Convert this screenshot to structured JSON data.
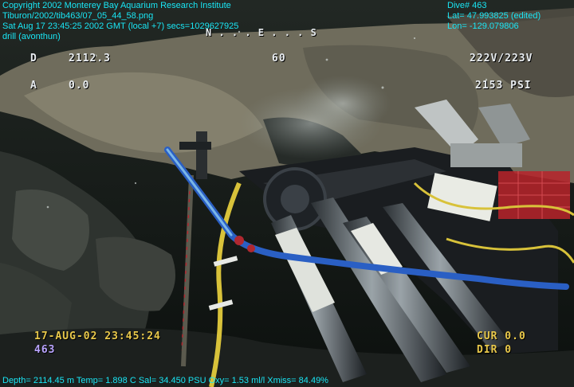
{
  "header": {
    "copyright": "Copyright 2002 Monterey Bay Aquarium Research Institute",
    "file_path": "Tiburon/2002/tib463/07_05_44_58.png",
    "timestamp": "Sat Aug 17 23:45:25 2002 GMT (local +7) secs=1029627925",
    "label": "drill (avonthun)"
  },
  "header_right": {
    "dive": "Dive# 463",
    "lat": "Lat= 47.993825 (edited)",
    "lon": "Lon= -129.079806"
  },
  "hud": {
    "compass": "N  .  .  .  E  .  .  .  S",
    "depth_label": "D",
    "depth_value": "2112.3",
    "heading": "60",
    "alt_label": "A",
    "alt_value": "0.0",
    "voltage": "222V/223V",
    "pressure": "2153 PSI",
    "datetime": "17-AUG-02 23:45:24",
    "dive_num": "463",
    "cur": "CUR 0.0",
    "dir": "DIR 0"
  },
  "footer": {
    "sensors": "Depth= 2114.45 m  Temp= 1.898 C  Sal= 34.450 PSU  Oxy= 1.53 ml/l  Xmiss= 84.49%"
  },
  "colors": {
    "caption": "#19e6f5",
    "hud_white": "#e8ecef",
    "hud_yellow": "#e8c84a",
    "hud_purple": "#b9a4ff"
  }
}
